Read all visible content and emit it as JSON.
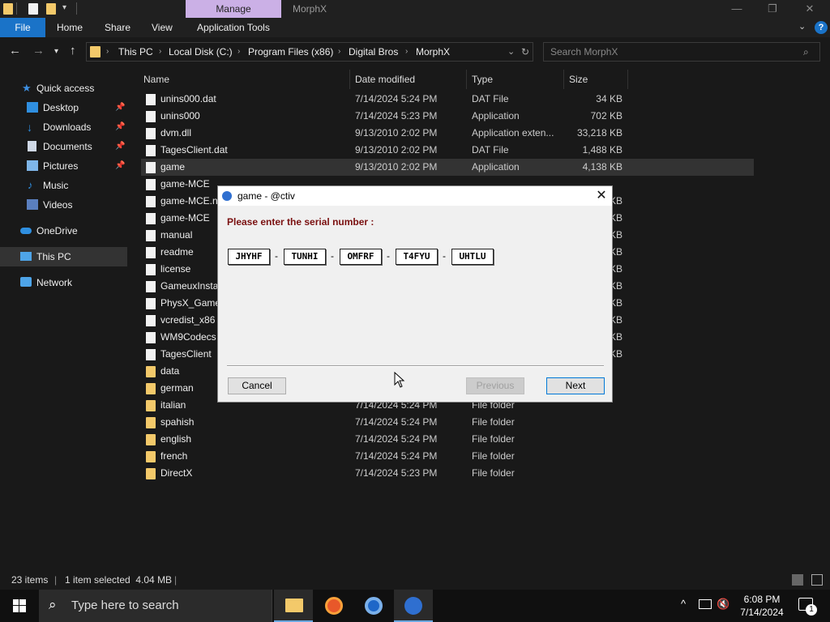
{
  "titlebar": {
    "manage_tab": "Manage",
    "window_title": "MorphX",
    "minimize": "—",
    "maximize": "❐",
    "close": "✕"
  },
  "ribbon": {
    "file": "File",
    "tabs": [
      "Home",
      "Share",
      "View",
      "Application Tools"
    ],
    "help": "?",
    "collapse": "⌄"
  },
  "address": {
    "crumbs": [
      "This PC",
      "Local Disk (C:)",
      "Program Files (x86)",
      "Digital Bros",
      "MorphX"
    ],
    "search_placeholder": "Search MorphX"
  },
  "sidebar": {
    "items": [
      {
        "label": "Quick access",
        "icon": "star-icon"
      },
      {
        "label": "Desktop",
        "icon": "desktop-icon"
      },
      {
        "label": "Downloads",
        "icon": "download-icon"
      },
      {
        "label": "Documents",
        "icon": "documents-icon"
      },
      {
        "label": "Pictures",
        "icon": "pictures-icon"
      },
      {
        "label": "Music",
        "icon": "music-icon"
      },
      {
        "label": "Videos",
        "icon": "videos-icon"
      },
      {
        "label": "OneDrive",
        "icon": "cloud-icon"
      },
      {
        "label": "This PC",
        "icon": "computer-icon"
      },
      {
        "label": "Network",
        "icon": "network-icon"
      }
    ]
  },
  "columns": {
    "name": "Name",
    "date": "Date modified",
    "type": "Type",
    "size": "Size"
  },
  "files": [
    {
      "name": "unins000.dat",
      "date": "7/14/2024 5:24 PM",
      "type": "DAT File",
      "size": "34 KB"
    },
    {
      "name": "unins000",
      "date": "7/14/2024 5:23 PM",
      "type": "Application",
      "size": "702 KB"
    },
    {
      "name": "dvm.dll",
      "date": "9/13/2010 2:02 PM",
      "type": "Application exten...",
      "size": "33,218 KB"
    },
    {
      "name": "TagesClient.dat",
      "date": "9/13/2010 2:02 PM",
      "type": "DAT File",
      "size": "1,488 KB"
    },
    {
      "name": "game",
      "date": "9/13/2010 2:02 PM",
      "type": "Application",
      "size": "4,138 KB"
    },
    {
      "name": "game-MCE",
      "date": "",
      "type": "",
      "size": ""
    },
    {
      "name": "game-MCE.n",
      "date": "",
      "type": "",
      "size": "KB"
    },
    {
      "name": "game-MCE",
      "date": "",
      "type": "",
      "size": "KB"
    },
    {
      "name": "manual",
      "date": "",
      "type": "",
      "size": "KB"
    },
    {
      "name": "readme",
      "date": "",
      "type": "",
      "size": "KB"
    },
    {
      "name": "license",
      "date": "",
      "type": "",
      "size": "KB"
    },
    {
      "name": "GameuxInsta",
      "date": "",
      "type": "",
      "size": "KB"
    },
    {
      "name": "PhysX_Game",
      "date": "",
      "type": "",
      "size": "KB"
    },
    {
      "name": "vcredist_x86",
      "date": "",
      "type": "",
      "size": "KB"
    },
    {
      "name": "WM9Codecs",
      "date": "",
      "type": "",
      "size": "KB"
    },
    {
      "name": "TagesClient",
      "date": "",
      "type": "",
      "size": "KB"
    },
    {
      "name": "data",
      "date": "",
      "type": "",
      "size": ""
    },
    {
      "name": "german",
      "date": "",
      "type": "",
      "size": ""
    },
    {
      "name": "italian",
      "date": "7/14/2024 5:24 PM",
      "type": "File folder",
      "size": ""
    },
    {
      "name": "spahish",
      "date": "7/14/2024 5:24 PM",
      "type": "File folder",
      "size": ""
    },
    {
      "name": "english",
      "date": "7/14/2024 5:24 PM",
      "type": "File folder",
      "size": ""
    },
    {
      "name": "french",
      "date": "7/14/2024 5:24 PM",
      "type": "File folder",
      "size": ""
    },
    {
      "name": "DirectX",
      "date": "7/14/2024 5:23 PM",
      "type": "File folder",
      "size": ""
    }
  ],
  "status": {
    "count": "23 items",
    "selected": "1 item selected  4.04 MB"
  },
  "dialog": {
    "title": "game - @ctiv",
    "close": "✕",
    "prompt": "Please enter the serial number :",
    "serial": [
      "JHYHF",
      "TUNHI",
      "OMFRF",
      "T4FYU",
      "UHTLU"
    ],
    "dash": "-",
    "cancel": "Cancel",
    "previous": "Previous",
    "next": "Next"
  },
  "taskbar": {
    "search_placeholder": "Type here to search",
    "time": "6:08 PM",
    "date": "7/14/2024",
    "notifications": "1"
  }
}
